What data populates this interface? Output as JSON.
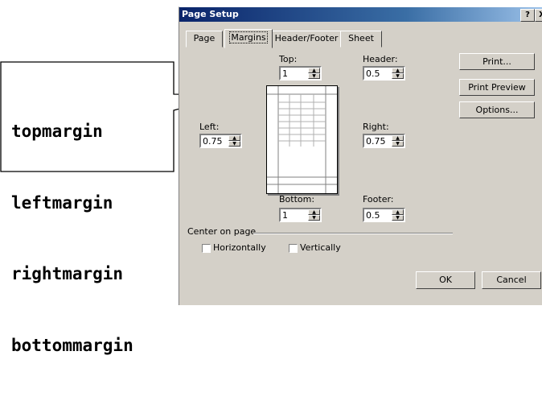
{
  "callout": {
    "lines": [
      "topmargin",
      "leftmargin",
      "rightmargin",
      "bottommargin"
    ]
  },
  "dialog": {
    "title": "Page Setup",
    "help_btn": "?",
    "close_btn": "X",
    "tabs": [
      "Page",
      "Margins",
      "Header/Footer",
      "Sheet"
    ],
    "top": {
      "label": "Top:",
      "value": "1"
    },
    "header": {
      "label": "Header:",
      "value": "0.5"
    },
    "left": {
      "label": "Left:",
      "value": "0.75"
    },
    "right": {
      "label": "Right:",
      "value": "0.75"
    },
    "bottom": {
      "label": "Bottom:",
      "value": "1"
    },
    "footer": {
      "label": "Footer:",
      "value": "0.5"
    },
    "buttons": {
      "print": "Print...",
      "print_preview": "Print Preview",
      "options": "Options...",
      "ok": "OK",
      "cancel": "Cancel"
    },
    "center_group": "Center on page",
    "horizontally": "Horizontally",
    "vertically": "Vertically"
  }
}
